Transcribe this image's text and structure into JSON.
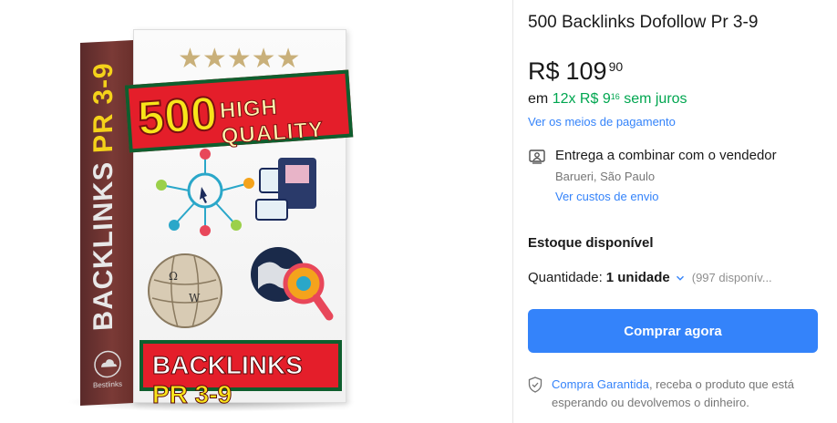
{
  "product": {
    "title": "500 Backlinks Dofollow Pr 3-9",
    "image": {
      "stars": "★★★★★",
      "count": "500",
      "headline": "HIGH QUALITY",
      "spine_word": "BACKLINKS",
      "spine_pr": "PR 3-9",
      "bottom_word": "BACKLINKS",
      "bottom_pr": "PR 3-9",
      "brand": "Bestlinks"
    }
  },
  "price": {
    "currency": "R$",
    "integer": "109",
    "cents": "90"
  },
  "installments": {
    "prefix": "em",
    "count_text": "12x R$ 9",
    "cents": "16",
    "suffix": "sem juros",
    "color": "#00a650"
  },
  "payment_link": "Ver os meios de pagamento",
  "delivery": {
    "icon": "person-card-icon",
    "title": "Entrega a combinar com o vendedor",
    "location": "Barueri, São Paulo",
    "link": "Ver custos de envio"
  },
  "stock": {
    "label": "Estoque disponível"
  },
  "quantity": {
    "label": "Quantidade:",
    "value": "1 unidade",
    "available": "(997 disponív..."
  },
  "buy_button": {
    "label": "Comprar agora",
    "color": "#3483fa"
  },
  "guarantee": {
    "icon": "shield-check-icon",
    "link": "Compra Garantida",
    "text": ", receba o produto que está esperando ou devolvemos o dinheiro."
  },
  "colors": {
    "accent": "#3483fa",
    "success": "#00a650"
  }
}
